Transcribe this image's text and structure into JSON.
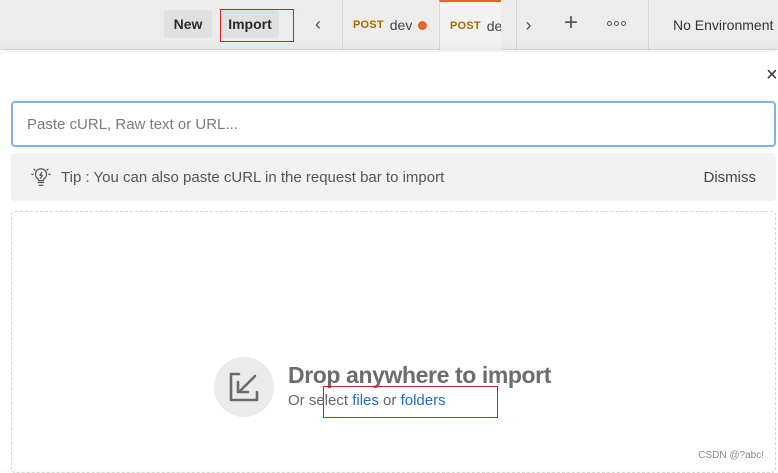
{
  "toolbar": {
    "new_label": "New",
    "import_label": "Import",
    "back_glyph": "‹",
    "forward_glyph": "›",
    "new_tab_glyph": "+",
    "more_icon": "more-options-icon",
    "environment": "No Environment"
  },
  "tabs": [
    {
      "method": "POST",
      "name": "dev",
      "unsaved": true
    },
    {
      "method": "POST",
      "name": "de",
      "active": true
    }
  ],
  "colors": {
    "accent": "#e3652b",
    "link": "#1f6fc5",
    "input_focus": "#7fb2ea",
    "highlight_box": "#d81e1e"
  },
  "modal": {
    "close_glyph": "×",
    "input_placeholder": "Paste cURL, Raw text or URL...",
    "tip_text": "Tip : You can also paste cURL in the request bar to import",
    "tip_dismiss": "Dismiss",
    "drop_title": "Drop anywhere to import",
    "drop_sub_prefix": "Or select ",
    "drop_files": "files",
    "drop_or": " or ",
    "drop_folders": "folders"
  },
  "watermark": "CSDN @?abc!"
}
